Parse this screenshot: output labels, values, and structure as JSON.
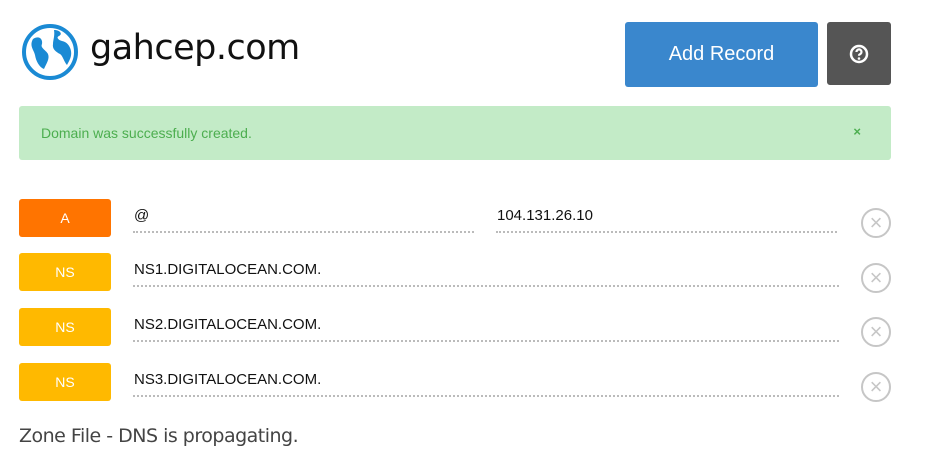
{
  "header": {
    "domain": "gahcep.com",
    "add_record": "Add Record"
  },
  "alert": {
    "message": "Domain was successfully created.",
    "close": "×"
  },
  "records": [
    {
      "type": "A",
      "color": "#ff7400",
      "name": "@",
      "value": "104.131.26.10"
    },
    {
      "type": "NS",
      "color": "#ffb900",
      "value": "NS1.DIGITALOCEAN.COM."
    },
    {
      "type": "NS",
      "color": "#ffb900",
      "value": "NS2.DIGITALOCEAN.COM."
    },
    {
      "type": "NS",
      "color": "#ffb900",
      "value": "NS3.DIGITALOCEAN.COM."
    }
  ],
  "footer": {
    "status": "Zone File - DNS is propagating."
  }
}
